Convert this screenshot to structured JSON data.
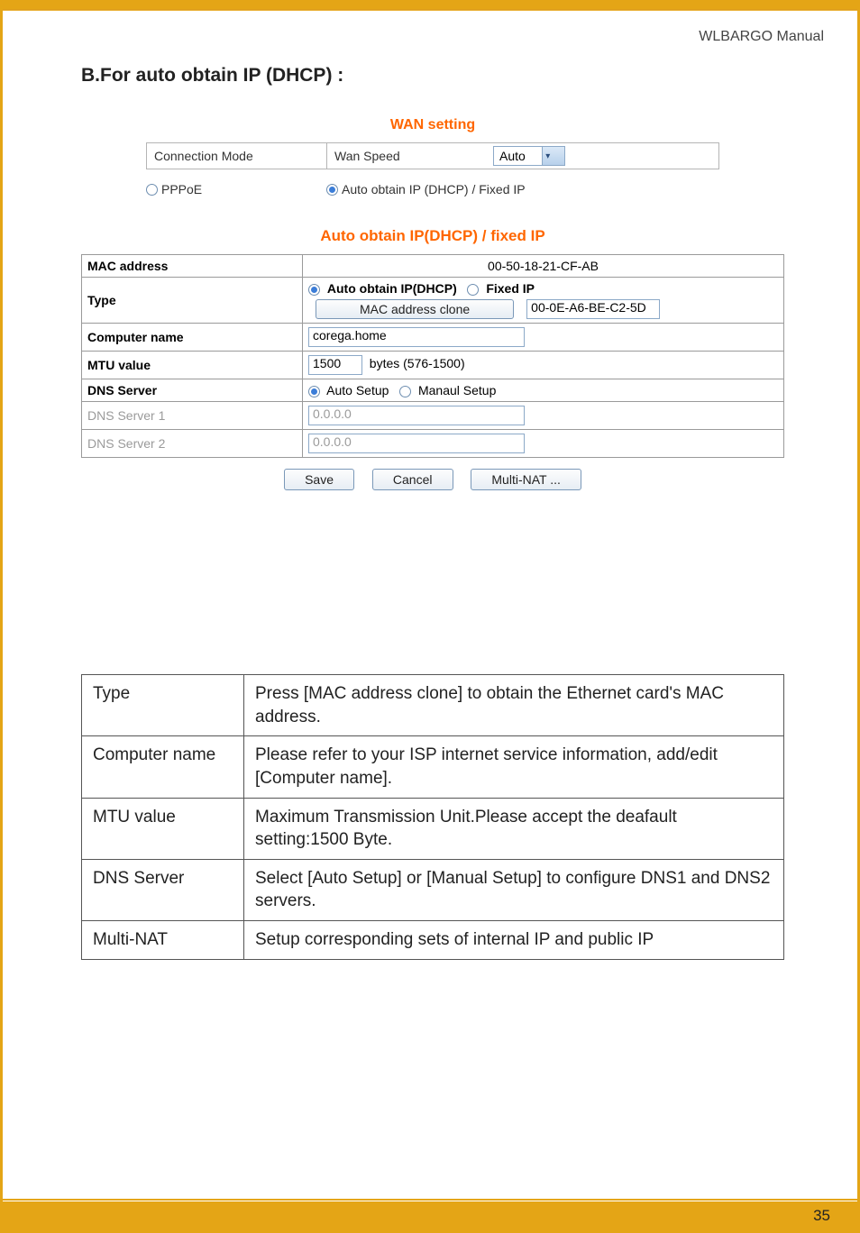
{
  "manual_title": "WLBARGO Manual",
  "section_heading": "B.For auto obtain IP (DHCP) :",
  "page_number": "35",
  "wan": {
    "title": "WAN setting",
    "conn_mode_label": "Connection Mode",
    "wan_speed_label": "Wan Speed",
    "wan_speed_value": "Auto",
    "pppoe_label": "PPPoE",
    "dhcp_label": "Auto obtain IP (DHCP) / Fixed IP"
  },
  "dhcp": {
    "title": "Auto obtain IP(DHCP) / fixed IP",
    "mac_label": "MAC address",
    "mac_value": "00-50-18-21-CF-AB",
    "type_label": "Type",
    "type_auto": "Auto obtain IP(DHCP)",
    "type_fixed": "Fixed IP",
    "mac_clone_btn": "MAC address  clone",
    "mac_clone_value": "00-0E-A6-BE-C2-5D",
    "computer_name_label": "Computer name",
    "computer_name_value": "corega.home",
    "mtu_label": "MTU value",
    "mtu_value": "1500",
    "mtu_hint": "bytes (576-1500)",
    "dns_label": "DNS Server",
    "dns_auto": "Auto Setup",
    "dns_manual": "Manaul Setup",
    "dns1_label": "DNS Server 1",
    "dns1_value": "0.0.0.0",
    "dns2_label": "DNS Server 2",
    "dns2_value": "0.0.0.0",
    "save_btn": "Save",
    "cancel_btn": "Cancel",
    "multinat_btn": "Multi-NAT ..."
  },
  "desc": {
    "r0k": "Type",
    "r0v": "Press [MAC address clone] to obtain the Ethernet card's MAC address.",
    "r1k": "Computer name",
    "r1v": "Please refer to your ISP internet service information, add/edit [Computer name].",
    "r2k": "MTU value",
    "r2v": "Maximum Transmission Unit.Please accept the deafault setting:1500 Byte.",
    "r3k": "DNS Server",
    "r3v": "Select [Auto Setup] or [Manual Setup] to configure DNS1 and DNS2 servers.",
    "r4k": "Multi-NAT",
    "r4v": "Setup corresponding sets of internal IP and public IP"
  }
}
